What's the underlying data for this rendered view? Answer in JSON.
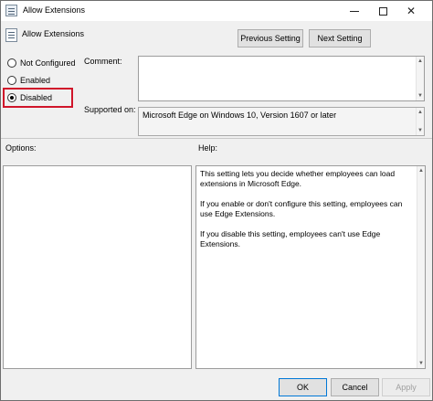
{
  "window": {
    "title": "Allow Extensions",
    "minimize_icon": "minimize-icon",
    "maximize_icon": "maximize-icon",
    "close_glyph": "✕"
  },
  "header": {
    "policy_name": "Allow Extensions",
    "previous_label": "Previous Setting",
    "next_label": "Next Setting"
  },
  "state": {
    "options": [
      {
        "label": "Not Configured",
        "checked": false
      },
      {
        "label": "Enabled",
        "checked": false
      },
      {
        "label": "Disabled",
        "checked": true
      }
    ],
    "highlight_color": "#d0152a"
  },
  "comment": {
    "label": "Comment:",
    "value": ""
  },
  "supported": {
    "label": "Supported on:",
    "value": "Microsoft Edge on Windows 10, Version 1607 or later"
  },
  "options_panel": {
    "label": "Options:"
  },
  "help_panel": {
    "label": "Help:",
    "paragraphs": [
      "This setting lets you decide whether employees can load extensions in Microsoft Edge.",
      "If you enable or don't configure this setting, employees can use Edge Extensions.",
      "If you disable this setting, employees can't use Edge Extensions."
    ]
  },
  "footer": {
    "ok_label": "OK",
    "cancel_label": "Cancel",
    "apply_label": "Apply"
  },
  "scroll": {
    "up_glyph": "▲",
    "down_glyph": "▼"
  }
}
